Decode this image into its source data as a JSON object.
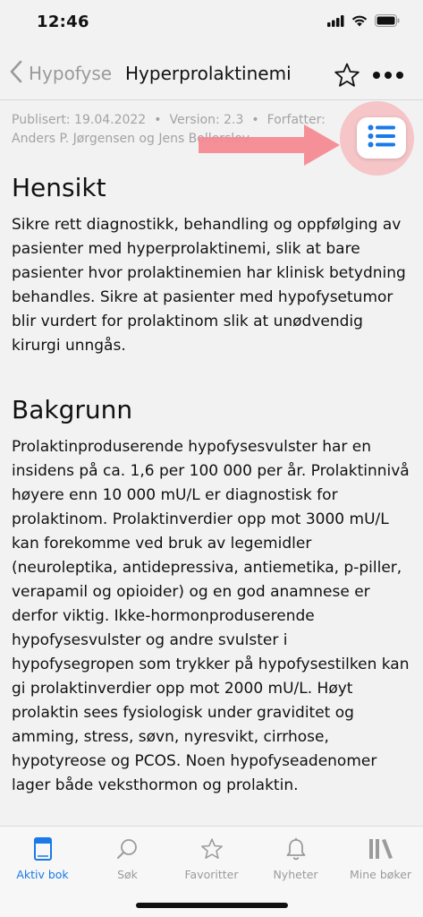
{
  "status": {
    "time": "12:46"
  },
  "nav": {
    "back_label": "Hypofyse",
    "title": "Hyperprolaktinemi"
  },
  "meta": {
    "published": "Publisert: 19.04.2022",
    "version": "Version: 2.3",
    "author_label": "Forfatter:",
    "authors": "Anders P. Jørgensen og Jens Bollerslev"
  },
  "sections": [
    {
      "heading": "Hensikt",
      "text": "Sikre rett diagnostikk, behandling og oppfølging av pasienter med hyperprolaktinemi, slik at bare pasienter hvor prolaktinemien har klinisk betydning behandles. Sikre at pasienter med hypofysetumor blir vurdert for prolaktinom slik at unødvendig kirurgi unngås."
    },
    {
      "heading": "Bakgrunn",
      "text": "Prolaktinproduserende hypofysesvulster har en insidens på ca. 1,6 per 100 000 per år. Prolaktinnivå høyere enn 10 000 mU/L er diagnostisk for prolaktinom. Prolaktinverdier opp mot 3000 mU/L kan forekomme ved bruk av legemidler (neuroleptika, antidepressiva, antiemetika, p-piller, verapamil og opioider) og en god anamnese er derfor viktig. Ikke-hormonproduserende hypofysesvulster og andre svulster i hypofysegropen som trykker på hypofysestilken kan gi prolaktinverdier opp mot 2000 mU/L. Høyt prolaktin sees fysiologisk under graviditet og amming, stress, søvn, nyresvikt, cirrhose, hypotyreose og PCOS. Noen hypofyseadenomer lager både veksthormon og prolaktin."
    }
  ],
  "tabs": [
    {
      "label": "Aktiv bok",
      "icon": "book-icon"
    },
    {
      "label": "Søk",
      "icon": "search-icon"
    },
    {
      "label": "Favoritter",
      "icon": "star-icon"
    },
    {
      "label": "Nyheter",
      "icon": "bell-icon"
    },
    {
      "label": "Mine bøker",
      "icon": "library-icon"
    }
  ],
  "colors": {
    "accent": "#1a7ae8",
    "highlight": "#f8a0a6"
  }
}
